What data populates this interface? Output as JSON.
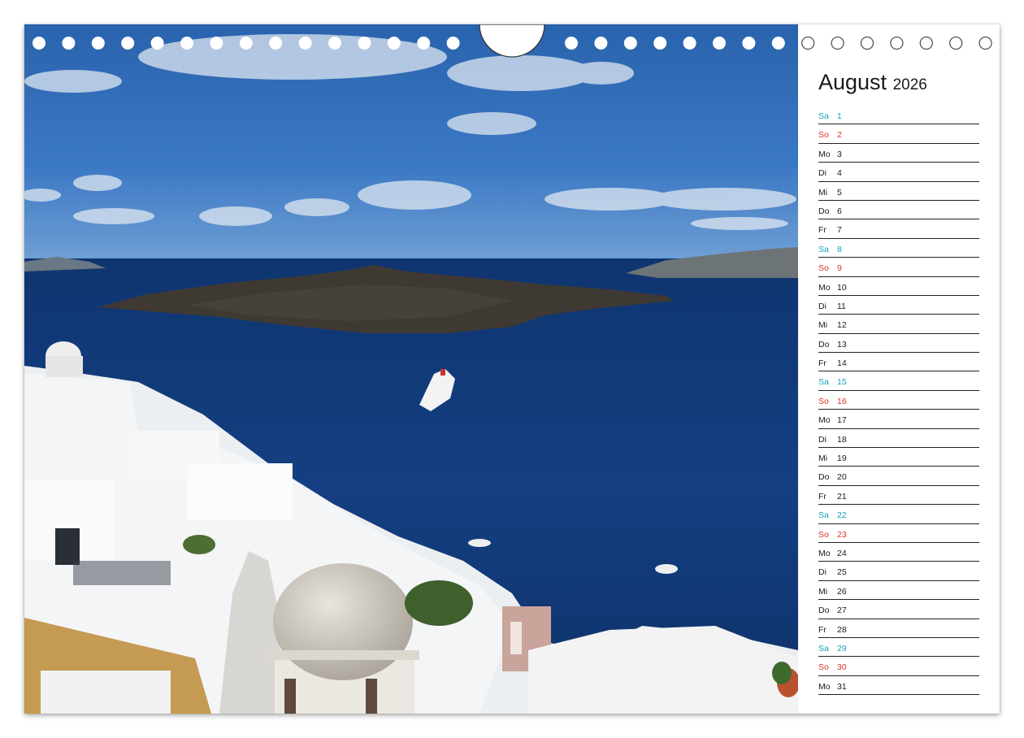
{
  "calendar": {
    "month": "August",
    "year": "2026",
    "days": [
      {
        "dow": "Sa",
        "num": "1",
        "kind": "sat"
      },
      {
        "dow": "So",
        "num": "2",
        "kind": "sun"
      },
      {
        "dow": "Mo",
        "num": "3",
        "kind": "week"
      },
      {
        "dow": "Di",
        "num": "4",
        "kind": "week"
      },
      {
        "dow": "Mi",
        "num": "5",
        "kind": "week"
      },
      {
        "dow": "Do",
        "num": "6",
        "kind": "week"
      },
      {
        "dow": "Fr",
        "num": "7",
        "kind": "week"
      },
      {
        "dow": "Sa",
        "num": "8",
        "kind": "sat"
      },
      {
        "dow": "So",
        "num": "9",
        "kind": "sun"
      },
      {
        "dow": "Mo",
        "num": "10",
        "kind": "week"
      },
      {
        "dow": "Di",
        "num": "11",
        "kind": "week"
      },
      {
        "dow": "Mi",
        "num": "12",
        "kind": "week"
      },
      {
        "dow": "Do",
        "num": "13",
        "kind": "week"
      },
      {
        "dow": "Fr",
        "num": "14",
        "kind": "week"
      },
      {
        "dow": "Sa",
        "num": "15",
        "kind": "sat"
      },
      {
        "dow": "So",
        "num": "16",
        "kind": "sun"
      },
      {
        "dow": "Mo",
        "num": "17",
        "kind": "week"
      },
      {
        "dow": "Di",
        "num": "18",
        "kind": "week"
      },
      {
        "dow": "Mi",
        "num": "19",
        "kind": "week"
      },
      {
        "dow": "Do",
        "num": "20",
        "kind": "week"
      },
      {
        "dow": "Fr",
        "num": "21",
        "kind": "week"
      },
      {
        "dow": "Sa",
        "num": "22",
        "kind": "sat"
      },
      {
        "dow": "So",
        "num": "23",
        "kind": "sun"
      },
      {
        "dow": "Mo",
        "num": "24",
        "kind": "week"
      },
      {
        "dow": "Di",
        "num": "25",
        "kind": "week"
      },
      {
        "dow": "Mi",
        "num": "26",
        "kind": "week"
      },
      {
        "dow": "Do",
        "num": "27",
        "kind": "week"
      },
      {
        "dow": "Fr",
        "num": "28",
        "kind": "week"
      },
      {
        "dow": "Sa",
        "num": "29",
        "kind": "sat"
      },
      {
        "dow": "So",
        "num": "30",
        "kind": "sun"
      },
      {
        "dow": "Mo",
        "num": "31",
        "kind": "week"
      }
    ]
  },
  "colors": {
    "saturday": "#17a2b8",
    "sunday": "#d9342b",
    "weekday": "#1a1a1a",
    "sea": "#123f7f",
    "sky": "#2f6fbf"
  }
}
